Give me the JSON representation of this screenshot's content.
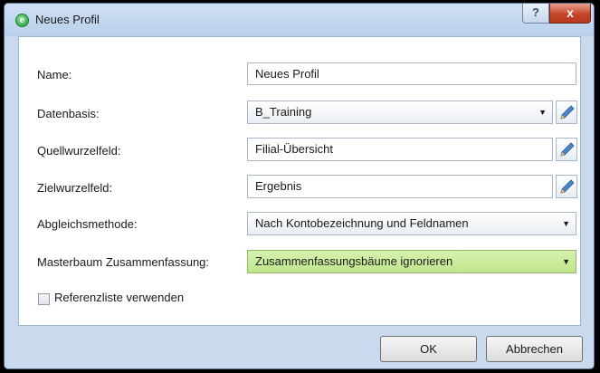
{
  "window": {
    "title": "Neues Profil",
    "help_label": "?",
    "close_label": "x",
    "app_icon_glyph": "e"
  },
  "form": {
    "name_label": "Name:",
    "name_value": "Neues Profil",
    "datenbasis_label": "Datenbasis:",
    "datenbasis_value": "B_Training",
    "quellwurzelfeld_label": "Quellwurzelfeld:",
    "quellwurzelfeld_value": "Filial-Übersicht",
    "zielwurzelfeld_label": "Zielwurzelfeld:",
    "zielwurzelfeld_value": "Ergebnis",
    "abgleichsmethode_label": "Abgleichsmethode:",
    "abgleichsmethode_value": "Nach Kontobezeichnung und Feldnamen",
    "masterbaum_label": "Masterbaum Zusammenfassung:",
    "masterbaum_value": "Zusammenfassungsbäume ignorieren",
    "referenzliste_label": "Referenzliste verwenden",
    "referenzliste_checked": false
  },
  "buttons": {
    "ok_label": "OK",
    "cancel_label": "Abbrechen"
  },
  "colors": {
    "highlight_select": "#c8ea9a",
    "window_frame": "#c9d9ee",
    "close_button": "#c5452b"
  },
  "icons": {
    "edit": "pencil-icon",
    "dropdown": "chevron-down-icon"
  }
}
